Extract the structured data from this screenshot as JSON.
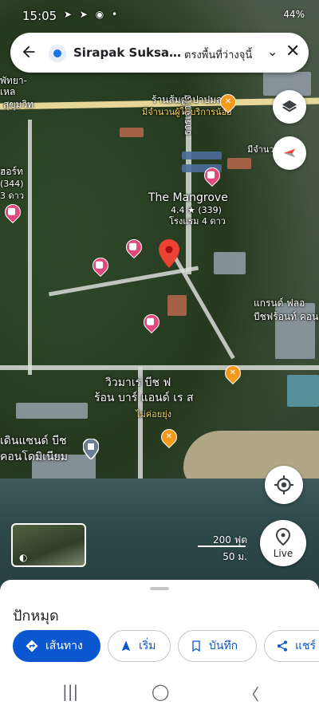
{
  "status_bar": {
    "time": "15:05",
    "notif_icons": "➤ ➤ ◉ •",
    "right_text": "44%"
  },
  "search": {
    "place_name": "Sirapak Suksamra...",
    "subtitle": "ตรงพื้นที่ว่างจุนี้"
  },
  "map": {
    "labels": {
      "sukhumvit_tail": "พัทยา-",
      "sukhumvit_tail2": "เหล",
      "sukhumvit": "สุขุมวิท",
      "restaurant": "ร้านส้มตำปาปมล",
      "restaurant_sub": "มีจำนวนผู้ใช้บริการน้อย",
      "street": "ธารเจ้าใจ",
      "left_hotel": "ฮอร์ท",
      "left_hotel_rating": "(344)",
      "left_hotel_class": "3 ดาว",
      "mangrove_name": "The Mangrove",
      "mangrove_rating": "4.4 ★ (339)",
      "mangrove_class": "โรงแรม 4 ดาว",
      "grand_line1": "แกรนด์ ฟลอ",
      "grand_line2": "บีชฟร้อนท์ คอน",
      "mee_right": "มีจำนวน",
      "wiwa_line1": "วิวมาเร่ บีช ฟ",
      "wiwa_line2": "ร้อน บาร์ แอนด์ เร ส",
      "wiwa_sub": "ไม่ค่อยยุ่ง",
      "dessanda_line1": "เดินแซนด์ บีช",
      "dessanda_line2": "คอนโดมิเนียม"
    },
    "scale_ft": "200 ฟุต",
    "scale_m": "50 ม.",
    "live_label": "Live"
  },
  "sheet": {
    "title": "ปักหมุด",
    "actions": {
      "directions": "เส้นทาง",
      "start": "เริ่ม",
      "save": "บันทึก",
      "share": "แชร์"
    }
  },
  "colors": {
    "accent": "#0b57d0",
    "pin_red": "#ea4335",
    "pin_hotel": "#e0497a",
    "pin_food": "#f19a1b"
  }
}
